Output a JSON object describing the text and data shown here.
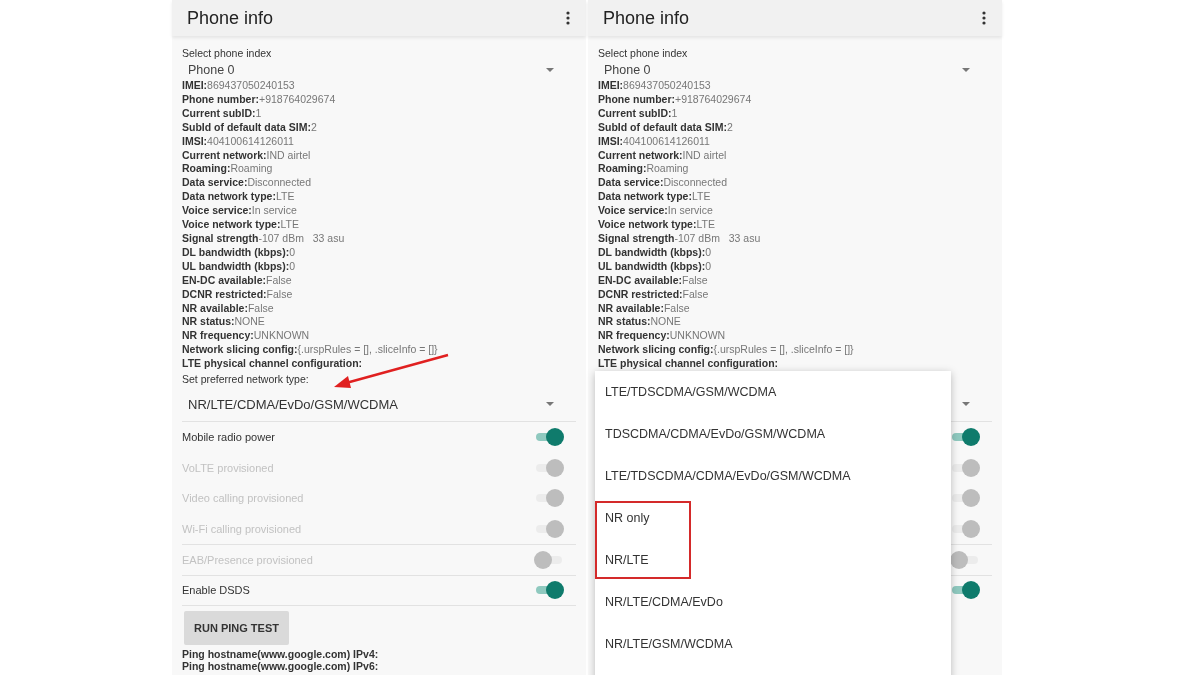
{
  "screens": [
    {
      "title": "Phone info",
      "phone_index_label": "Select phone index",
      "phone_index_value": "Phone 0",
      "info": [
        {
          "label": "IMEI:",
          "value": "869437050240153"
        },
        {
          "label": "Phone number:",
          "value": "+918764029674"
        },
        {
          "label": "Current subID:",
          "value": "1"
        },
        {
          "label": "SubId of default data SIM:",
          "value": "2"
        },
        {
          "label": "IMSI:",
          "value": "404100614126011"
        },
        {
          "label": "Current network:",
          "value": "IND airtel"
        },
        {
          "label": "Roaming:",
          "value": "Roaming"
        },
        {
          "label": "Data service:",
          "value": "Disconnected"
        },
        {
          "label": "Data network type:",
          "value": "LTE"
        },
        {
          "label": "Voice service:",
          "value": "In service"
        },
        {
          "label": "Voice network type:",
          "value": "LTE"
        },
        {
          "label": "Signal strength",
          "value": "-107 dBm   33 asu"
        },
        {
          "label": "DL bandwidth (kbps):",
          "value": "0"
        },
        {
          "label": "UL bandwidth (kbps):",
          "value": "0"
        },
        {
          "label": "EN-DC available:",
          "value": "False"
        },
        {
          "label": "DCNR restricted:",
          "value": "False"
        },
        {
          "label": "NR available:",
          "value": "False"
        },
        {
          "label": "NR status:",
          "value": "NONE"
        },
        {
          "label": "NR frequency:",
          "value": "UNKNOWN"
        },
        {
          "label": "Network slicing config:",
          "value": "{.urspRules = [], .sliceInfo = []}"
        },
        {
          "label": "LTE physical channel configuration:"
        }
      ],
      "preferred_label": "Set preferred network type:",
      "preferred_value": "NR/LTE/CDMA/EvDo/GSM/WCDMA",
      "switches": [
        {
          "label": "Mobile radio power",
          "on": true,
          "disabled": false
        },
        {
          "label": "VoLTE provisioned",
          "on": true,
          "disabled": true
        },
        {
          "label": "Video calling provisioned",
          "on": true,
          "disabled": true
        },
        {
          "label": "Wi-Fi calling provisioned",
          "on": true,
          "disabled": true
        },
        {
          "label": "EAB/Presence provisioned",
          "on": false,
          "disabled": true
        },
        {
          "label": "Enable DSDS",
          "on": true,
          "disabled": false
        }
      ],
      "ping_button": "RUN PING TEST",
      "ping_lines": [
        "Ping hostname(www.google.com) IPv4:",
        "Ping hostname(www.google.com) IPv6:"
      ],
      "annotation": {
        "kind": "arrow"
      }
    },
    {
      "title": "Phone info",
      "phone_index_label": "Select phone index",
      "phone_index_value": "Phone 0",
      "info": [
        {
          "label": "IMEI:",
          "value": "869437050240153"
        },
        {
          "label": "Phone number:",
          "value": "+918764029674"
        },
        {
          "label": "Current subID:",
          "value": "1"
        },
        {
          "label": "SubId of default data SIM:",
          "value": "2"
        },
        {
          "label": "IMSI:",
          "value": "404100614126011"
        },
        {
          "label": "Current network:",
          "value": "IND airtel"
        },
        {
          "label": "Roaming:",
          "value": "Roaming"
        },
        {
          "label": "Data service:",
          "value": "Disconnected"
        },
        {
          "label": "Data network type:",
          "value": "LTE"
        },
        {
          "label": "Voice service:",
          "value": "In service"
        },
        {
          "label": "Voice network type:",
          "value": "LTE"
        },
        {
          "label": "Signal strength",
          "value": "-107 dBm   33 asu"
        },
        {
          "label": "DL bandwidth (kbps):",
          "value": "0"
        },
        {
          "label": "UL bandwidth (kbps):",
          "value": "0"
        },
        {
          "label": "EN-DC available:",
          "value": "False"
        },
        {
          "label": "DCNR restricted:",
          "value": "False"
        },
        {
          "label": "NR available:",
          "value": "False"
        },
        {
          "label": "NR status:",
          "value": "NONE"
        },
        {
          "label": "NR frequency:",
          "value": "UNKNOWN"
        },
        {
          "label": "Network slicing config:",
          "value": "{.urspRules = [], .sliceInfo = []}"
        },
        {
          "label": "LTE physical channel configuration:"
        }
      ],
      "switches": [
        {
          "on": true,
          "disabled": false
        },
        {
          "on": true,
          "disabled": true
        },
        {
          "on": true,
          "disabled": true
        },
        {
          "on": true,
          "disabled": true
        },
        {
          "on": false,
          "disabled": true
        },
        {
          "on": true,
          "disabled": false
        }
      ],
      "menu_options": [
        {
          "label": "LTE/TDSCDMA/GSM/WCDMA",
          "highlighted": false
        },
        {
          "label": "TDSCDMA/CDMA/EvDo/GSM/WCDMA",
          "highlighted": false
        },
        {
          "label": "LTE/TDSCDMA/CDMA/EvDo/GSM/WCDMA",
          "highlighted": false
        },
        {
          "label": "NR only",
          "highlighted": true
        },
        {
          "label": "NR/LTE",
          "highlighted": true
        },
        {
          "label": "NR/LTE/CDMA/EvDo",
          "highlighted": false
        },
        {
          "label": "NR/LTE/GSM/WCDMA",
          "highlighted": false
        }
      ]
    }
  ]
}
